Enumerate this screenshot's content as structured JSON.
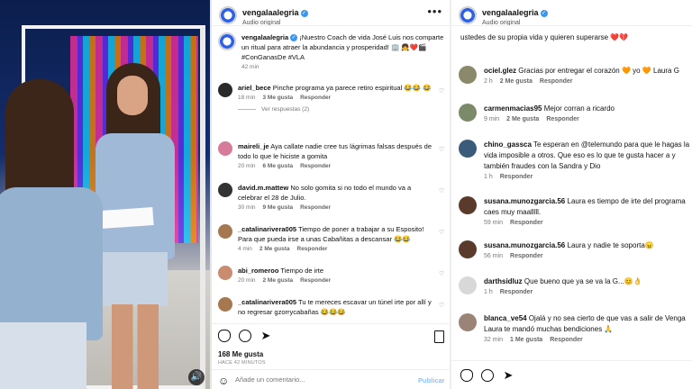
{
  "post": {
    "account": "vengalaalegria",
    "audio": "Audio original",
    "caption": "¡Nuestro Coach de vida José Luis nos comparte un ritual para atraer la abundancia y prosperidad! 🏢 👧❤️🎬 #ConGanasDe #VLA",
    "caption_time": "42 min",
    "likes": "168 Me gusta",
    "time_ago": "HACE 42 MINUTOS",
    "add_comment_placeholder": "Añade un comentario...",
    "publish_label": "Publicar"
  },
  "left_comments": [
    {
      "user": "ariel_bece",
      "text": "Pinche programa ya parece retiro espiritual 😂😂 😂",
      "time": "18 min",
      "likes": "3 Me gusta",
      "reply": "Responder",
      "replies": "Ver respuestas (2)"
    },
    {
      "user": "maireli_je",
      "text": "Aya callate nadie cree tus lágrimas falsas después de todo lo que le hiciste a gomita",
      "time": "20 min",
      "likes": "6 Me gusta",
      "reply": "Responder"
    },
    {
      "user": "david.m.mattew",
      "text": "No solo gomita si no todo el mundo va a celebrar el 28 de Julio.",
      "time": "30 min",
      "likes": "9 Me gusta",
      "reply": "Responder"
    },
    {
      "user": "_catalinarivera005",
      "text": "Tiempo de poner a trabajar a su Esposito! Para que pueda irse a unas Cabañitas a descansar 😂😂",
      "time": "4 min",
      "likes": "2 Me gusta",
      "reply": "Responder"
    },
    {
      "user": "abi_romeroo",
      "text": "Tiempo de irte",
      "time": "20 min",
      "likes": "2 Me gusta",
      "reply": "Responder"
    },
    {
      "user": "_catalinarivera005",
      "text": "Tu te mereces escavar un túnel irte por allí y no regresar gzorrycabañas 😂😂😂",
      "time": "",
      "likes": "",
      "reply": ""
    }
  ],
  "right_comments": [
    {
      "user": "",
      "text": "ustedes de su propia vida y quieren superarse ❤️💔",
      "time": "",
      "likes": "",
      "reply": ""
    },
    {
      "user": "ociel.glez",
      "text": "Gracias por entregar el corazón 🧡 yo 🧡 Laura G",
      "time": "2 h",
      "likes": "2 Me gusta",
      "reply": "Responder"
    },
    {
      "user": "carmenmacias95",
      "text": "Mejor corran a ricardo",
      "time": "9 min",
      "likes": "2 Me gusta",
      "reply": "Responder"
    },
    {
      "user": "chino_gassca",
      "text": "Te esperan en @telemundo para que le hagas la vida imposible a otros. Que eso es lo que te gusta hacer a y también fraudes con la Sandra y Dio",
      "time": "1 h",
      "likes": "",
      "reply": "Responder"
    },
    {
      "user": "susana.munozgarcia.56",
      "text": "Laura es tiempo de irte del programa caes muy maalllll.",
      "time": "59 min",
      "likes": "",
      "reply": "Responder"
    },
    {
      "user": "susana.munozgarcia.56",
      "text": "Laura y nadie te soporta😠",
      "time": "56 min",
      "likes": "",
      "reply": "Responder"
    },
    {
      "user": "darthsidluz",
      "text": "Que bueno que ya se va la G...😊👌",
      "time": "1 h",
      "likes": "",
      "reply": "Responder"
    },
    {
      "user": "blanca_ve54",
      "text": "Ojalá y no sea cierto de que vas a salir de Venga Laura te mandó muchas bendiciones 🙏",
      "time": "32 min",
      "likes": "1 Me gusta",
      "reply": "Responder"
    }
  ],
  "icons": {
    "like": "heart-icon",
    "comment": "comment-icon",
    "share": "send-icon",
    "save": "bookmark-icon",
    "more": "more-icon",
    "emoji": "emoji-icon",
    "verified": "verified-badge-icon"
  },
  "colors": {
    "verified": "#3897f0",
    "link": "#00376b",
    "publish": "#8fc3f5"
  }
}
